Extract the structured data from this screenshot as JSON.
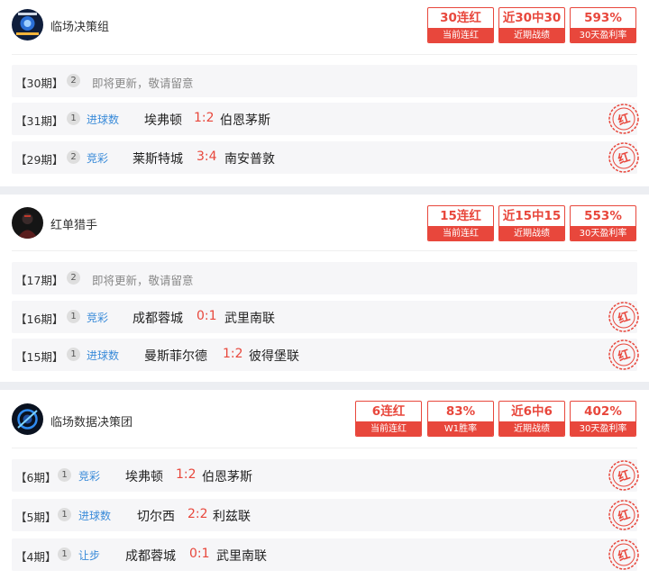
{
  "experts": [
    {
      "name": "临场决策组",
      "stats": [
        {
          "value": "30连红",
          "label": "当前连红"
        },
        {
          "value": "近30中30",
          "label": "近期战绩"
        },
        {
          "value": "593%",
          "label": "30天盈利率"
        }
      ],
      "pending": {
        "period": "【30期】",
        "count": "2",
        "text": "即将更新，敬请留意"
      },
      "picks": [
        {
          "period": "【31期】",
          "count": "1",
          "type": "进球数",
          "home": "埃弗顿",
          "score": "1:2",
          "away": "伯恩茅斯",
          "stamp": "红"
        },
        {
          "period": "【29期】",
          "count": "2",
          "type": "竞彩",
          "home": "莱斯特城",
          "score": "3:4",
          "away": "南安普敦",
          "stamp": "红"
        }
      ]
    },
    {
      "name": "红单猎手",
      "stats": [
        {
          "value": "15连红",
          "label": "当前连红"
        },
        {
          "value": "近15中15",
          "label": "近期战绩"
        },
        {
          "value": "553%",
          "label": "30天盈利率"
        }
      ],
      "pending": {
        "period": "【17期】",
        "count": "2",
        "text": "即将更新，敬请留意"
      },
      "picks": [
        {
          "period": "【16期】",
          "count": "1",
          "type": "竞彩",
          "home": "成都蓉城",
          "score": "0:1",
          "away": "武里南联",
          "stamp": "红"
        },
        {
          "period": "【15期】",
          "count": "1",
          "type": "进球数",
          "home": "曼斯菲尔德",
          "score": "1:2",
          "away": "彼得堡联",
          "stamp": "红"
        }
      ]
    },
    {
      "name": "临场数据决策团",
      "stats": [
        {
          "value": "6连红",
          "label": "当前连红"
        },
        {
          "value": "83%",
          "label": "W1胜率"
        },
        {
          "value": "近6中6",
          "label": "近期战绩"
        },
        {
          "value": "402%",
          "label": "30天盈利率"
        }
      ],
      "picks": [
        {
          "period": "【6期】",
          "count": "1",
          "type": "竞彩",
          "home": "埃弗顿",
          "score": "1:2",
          "away": "伯恩茅斯",
          "stamp": "红"
        },
        {
          "period": "【5期】",
          "count": "1",
          "type": "进球数",
          "home": "切尔西",
          "score": "2:2",
          "away": "利兹联",
          "stamp": "红"
        },
        {
          "period": "【4期】",
          "count": "1",
          "type": "让步",
          "home": "成都蓉城",
          "score": "0:1",
          "away": "武里南联",
          "stamp": "红"
        }
      ]
    }
  ],
  "colors": {
    "accent": "#e8473c",
    "link": "#3a8bd9",
    "row_bg": "#f6f6f8",
    "page_bg": "#eceef2"
  }
}
